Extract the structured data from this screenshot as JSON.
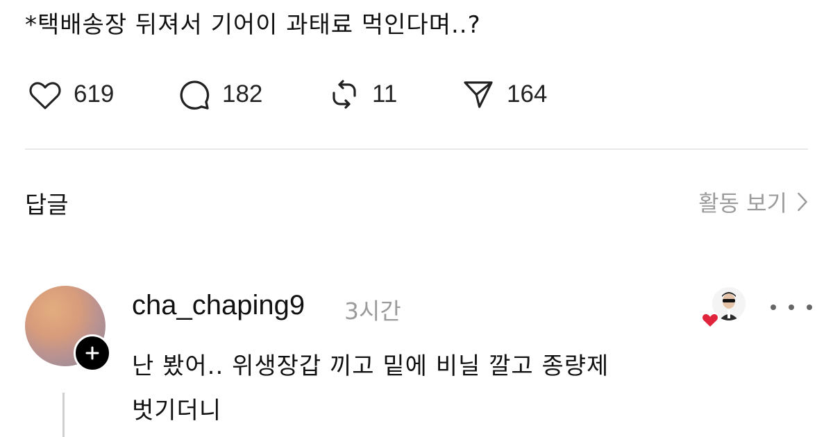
{
  "post": {
    "text": "*택배송장 뒤져서 기어이 과태료 먹인다며..?",
    "likes": "619",
    "comments": "182",
    "reposts": "11",
    "shares": "164"
  },
  "replies_section": {
    "title": "답글",
    "activity_label": "활동 보기"
  },
  "reply": {
    "username": "cha_chaping9",
    "time": "3시간",
    "text_line1": "난 봤어.. 위생장갑 끼고 밑에 비닐 깔고 종량제",
    "text_line2": "벗기더니"
  },
  "icons": {
    "like": "heart-outline-icon",
    "comment": "speech-bubble-icon",
    "repost": "repost-arrows-icon",
    "share": "paper-plane-icon",
    "chevron": "chevron-right-icon",
    "follow": "plus-icon",
    "liked": "red-heart-icon",
    "more": "ellipsis-icon"
  },
  "colors": {
    "text": "#111111",
    "muted": "#9b9b9b",
    "divider": "#e8e8e8",
    "heart": "#e0243c"
  }
}
